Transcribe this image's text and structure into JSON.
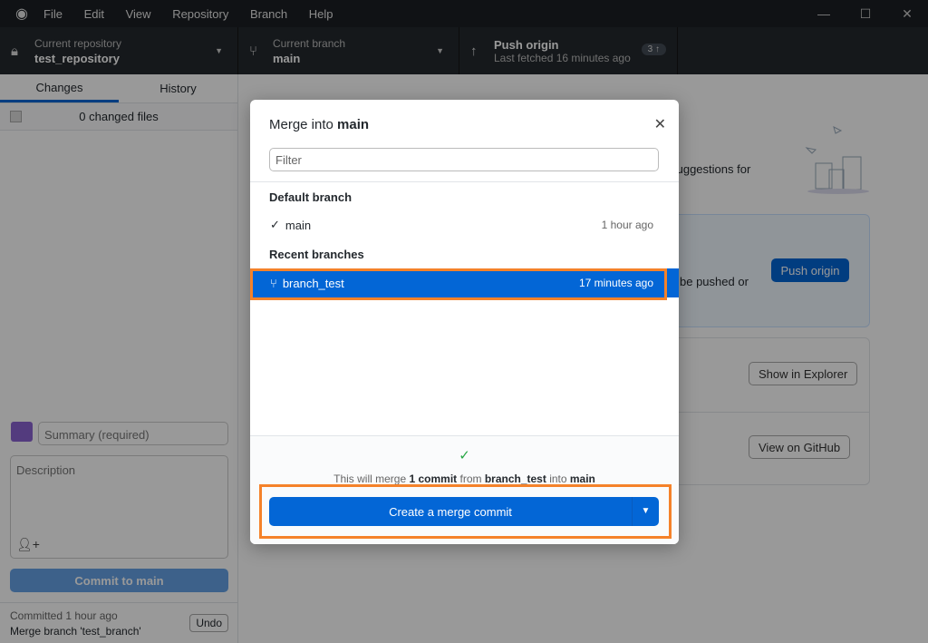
{
  "menu": [
    "File",
    "Edit",
    "View",
    "Repository",
    "Branch",
    "Help"
  ],
  "toolbar": {
    "repo_label": "Current repository",
    "repo_value": "test_repository",
    "branch_label": "Current branch",
    "branch_value": "main",
    "push_label": "Push origin",
    "push_sub": "Last fetched 16 minutes ago",
    "push_badge": "3 ↑"
  },
  "sidebar": {
    "tabs": [
      "Changes",
      "History"
    ],
    "changed": "0 changed files",
    "summary_placeholder": "Summary (required)",
    "description_placeholder": "Description",
    "commit_button": "Commit to main",
    "last_commit_time": "Committed 1 hour ago",
    "last_commit_msg": "Merge branch 'test_branch'",
    "undo": "Undo"
  },
  "main": {
    "fragment1": "y suggestions for",
    "fragment2": "be pushed or",
    "push_button": "Push origin",
    "show_explorer": "Show in Explorer",
    "view_github": "View on GitHub"
  },
  "modal": {
    "title_prefix": "Merge into ",
    "title_branch": "main",
    "filter_placeholder": "Filter",
    "default_header": "Default branch",
    "default_branch": {
      "name": "main",
      "time": "1 hour ago"
    },
    "recent_header": "Recent branches",
    "recent_branch": {
      "name": "branch_test",
      "time": "17 minutes ago"
    },
    "msg": {
      "p1": "This will merge ",
      "count": "1 commit",
      "p2": " from ",
      "from": "branch_test",
      "p3": " into ",
      "into": "main"
    },
    "merge_button": "Create a merge commit"
  },
  "colors": {
    "accent": "#0366d6",
    "highlight": "#f5822a",
    "success": "#28a745"
  }
}
